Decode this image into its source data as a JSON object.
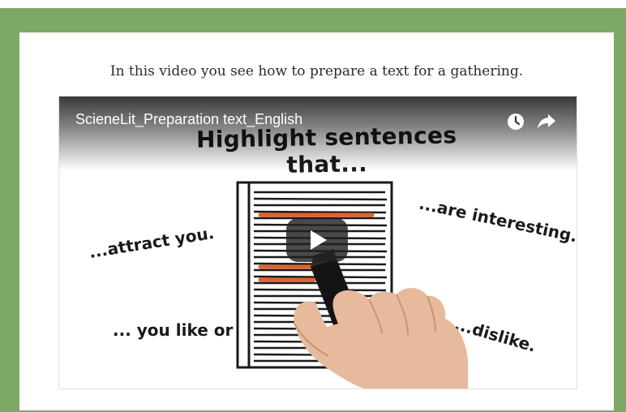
{
  "page": {
    "intro_text": "In this video you see how to prepare a text for a gathering."
  },
  "video": {
    "title": "ScieneLit_Preparation text_English",
    "headline": "Highlight sentences that...",
    "phrases": {
      "attract": "...attract you.",
      "interesting": "...are interesting.",
      "like": "... you like or",
      "dislike": "...dislike."
    },
    "controls": {
      "watch_later_icon": "clock-icon",
      "share_icon": "share-arrow-icon",
      "play_icon": "play-icon"
    }
  },
  "colors": {
    "frame_green": "#7da866",
    "highlight_orange": "#e0622f",
    "play_button": "#212121"
  }
}
